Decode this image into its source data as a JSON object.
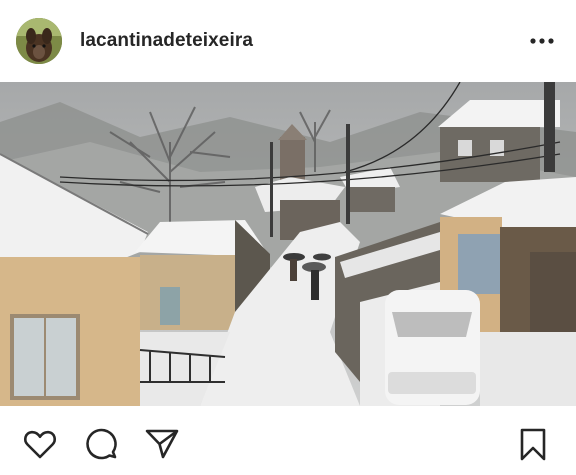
{
  "post": {
    "username": "lacantinadeteixeira"
  },
  "icons": {
    "avatar": "avatar-image",
    "more": "more-options-icon",
    "like": "heart-icon",
    "comment": "comment-bubble-icon",
    "share": "paper-plane-icon",
    "save": "bookmark-icon",
    "mute": "speaker-muted-icon"
  },
  "colors": {
    "text": "#262626",
    "background": "#ffffff"
  }
}
